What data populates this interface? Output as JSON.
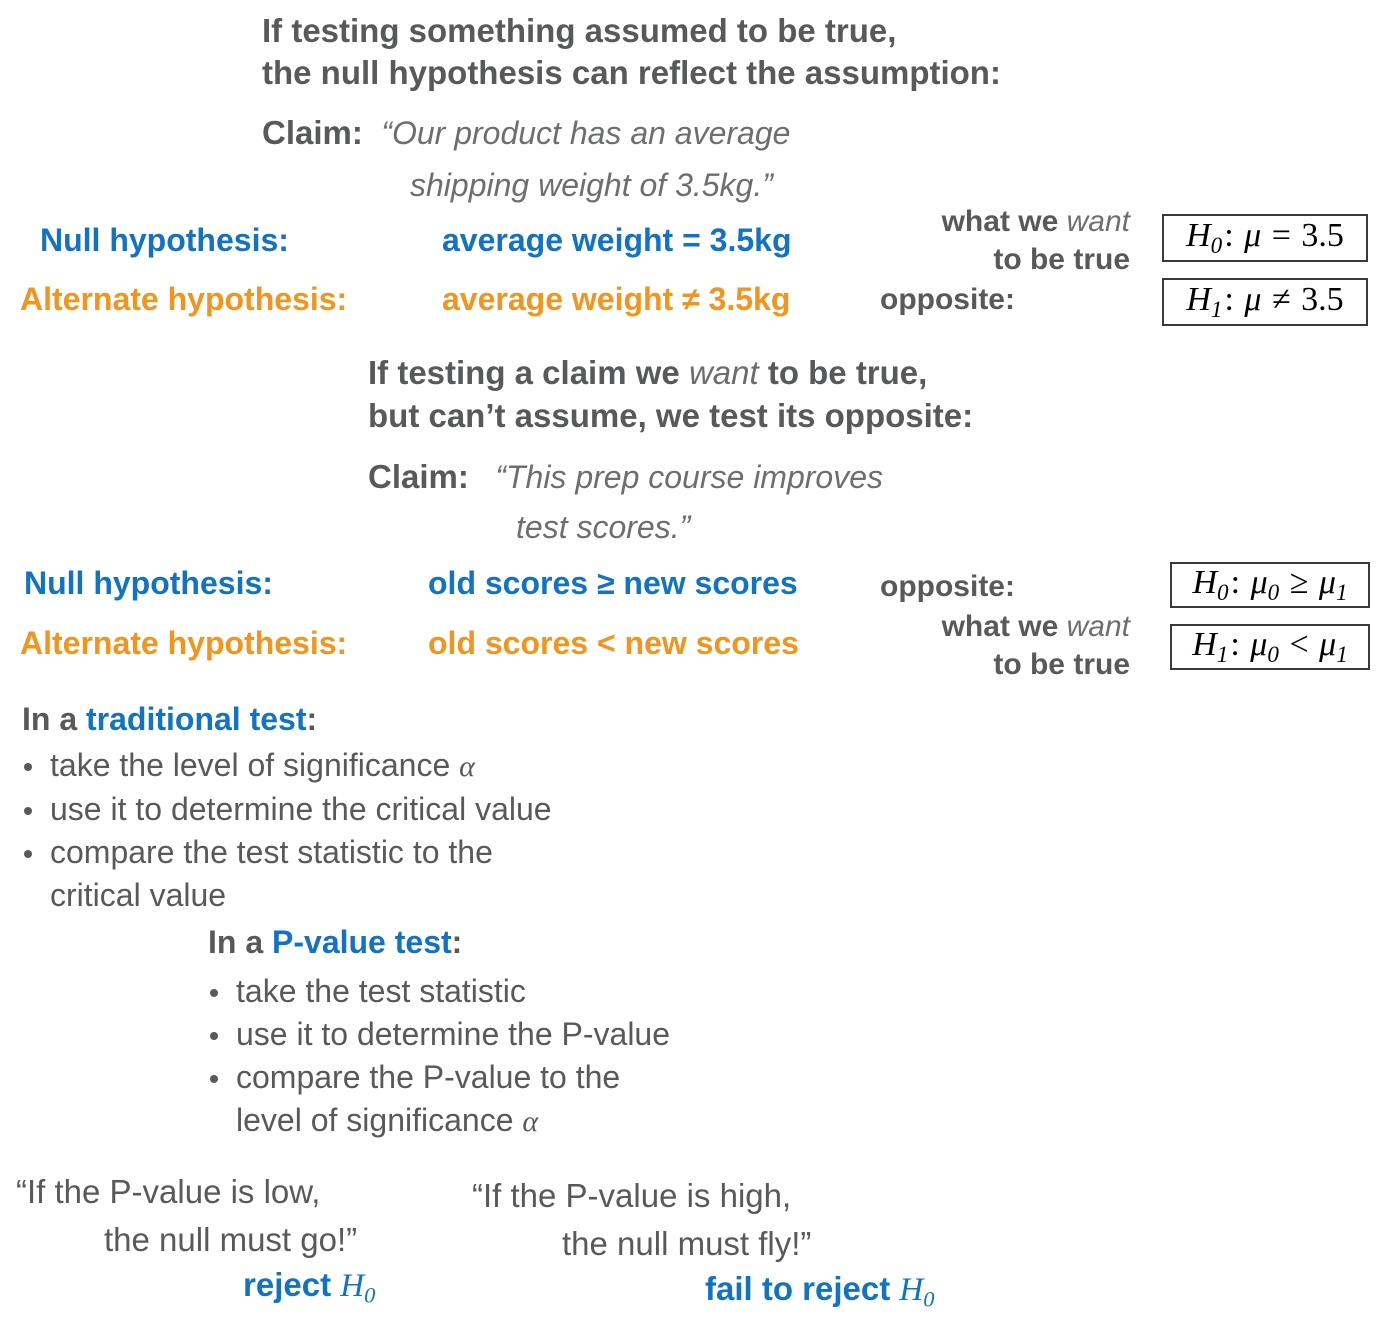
{
  "colors": {
    "gray": "#58595b",
    "blue": "#1272c4",
    "orange": "#f2941e",
    "box_border": "#3a3a3a"
  },
  "section1": {
    "intro_line1": "If testing something assumed to be true,",
    "intro_line2": "the null hypothesis can reflect the assumption:",
    "claim_label": "Claim:",
    "claim_line1": "“Our product has an average",
    "claim_line2": "shipping weight of 3.5kg.”",
    "null_label": "Null hypothesis:",
    "null_value": "average weight = 3.5kg",
    "alt_label": "Alternate hypothesis:",
    "alt_value": "average weight ≠ 3.5kg",
    "note_want_a": "what we ",
    "note_want_b": "want",
    "note_want_c": "to be true",
    "note_opposite": "opposite:",
    "box_h0": {
      "symbol": "H",
      "sub": "0",
      "sep": ":",
      "var": "μ",
      "op": "=",
      "value": "3.5"
    },
    "box_h1": {
      "symbol": "H",
      "sub": "1",
      "sep": ":",
      "var": "μ",
      "op": "≠",
      "value": "3.5"
    }
  },
  "section2": {
    "intro_line1_a": "If testing a claim we ",
    "intro_line1_b": "want",
    "intro_line1_c": " to be true,",
    "intro_line2": "but can’t assume, we test its opposite:",
    "claim_label": "Claim:",
    "claim_line1": "“This prep course improves",
    "claim_line2": "test scores.”",
    "null_label": "Null hypothesis:",
    "null_value": "old scores ≥ new scores",
    "alt_label": "Alternate hypothesis:",
    "alt_value": "old scores < new scores",
    "note_opposite": "opposite:",
    "note_want_a": "what we ",
    "note_want_b": "want",
    "note_want_c": "to be true",
    "box_h0": {
      "symbol": "H",
      "sub": "0",
      "sep": ":",
      "var": "μ",
      "varsub": "0",
      "op": "≥",
      "var2": "μ",
      "var2sub": "1"
    },
    "box_h1": {
      "symbol": "H",
      "sub": "1",
      "sep": ":",
      "var": "μ",
      "varsub": "0",
      "op": "<",
      "var2": "μ",
      "var2sub": "1"
    }
  },
  "traditional_test": {
    "head_pre": "In a ",
    "head_bold": "traditional test",
    "head_post": ":",
    "bullets": [
      {
        "text": "take the level of significance ",
        "math": "α"
      },
      {
        "text": "use it to determine the critical value",
        "math": ""
      },
      {
        "text": "compare the test statistic to the",
        "math": ""
      }
    ],
    "bullet3_cont": "critical value"
  },
  "pvalue_test": {
    "head_pre": "In a ",
    "head_bold": "P-value test",
    "head_post": ":",
    "bullets": [
      {
        "text": "take the test statistic",
        "math": ""
      },
      {
        "text": "use it to determine the P-value",
        "math": ""
      },
      {
        "text": "compare the P-value to the",
        "math": ""
      }
    ],
    "bullet3_cont_text": "level of significance ",
    "bullet3_cont_math": "α"
  },
  "bottom": {
    "left_line1": "“If the P-value is low,",
    "left_line2": "the null must go!”",
    "left_verdict_text": "reject ",
    "left_verdict_math": "H",
    "left_verdict_sub": "0",
    "right_line1": "“If the P-value is high,",
    "right_line2": "the null must fly!”",
    "right_verdict_text": "fail to reject ",
    "right_verdict_math": "H",
    "right_verdict_sub": "0"
  }
}
